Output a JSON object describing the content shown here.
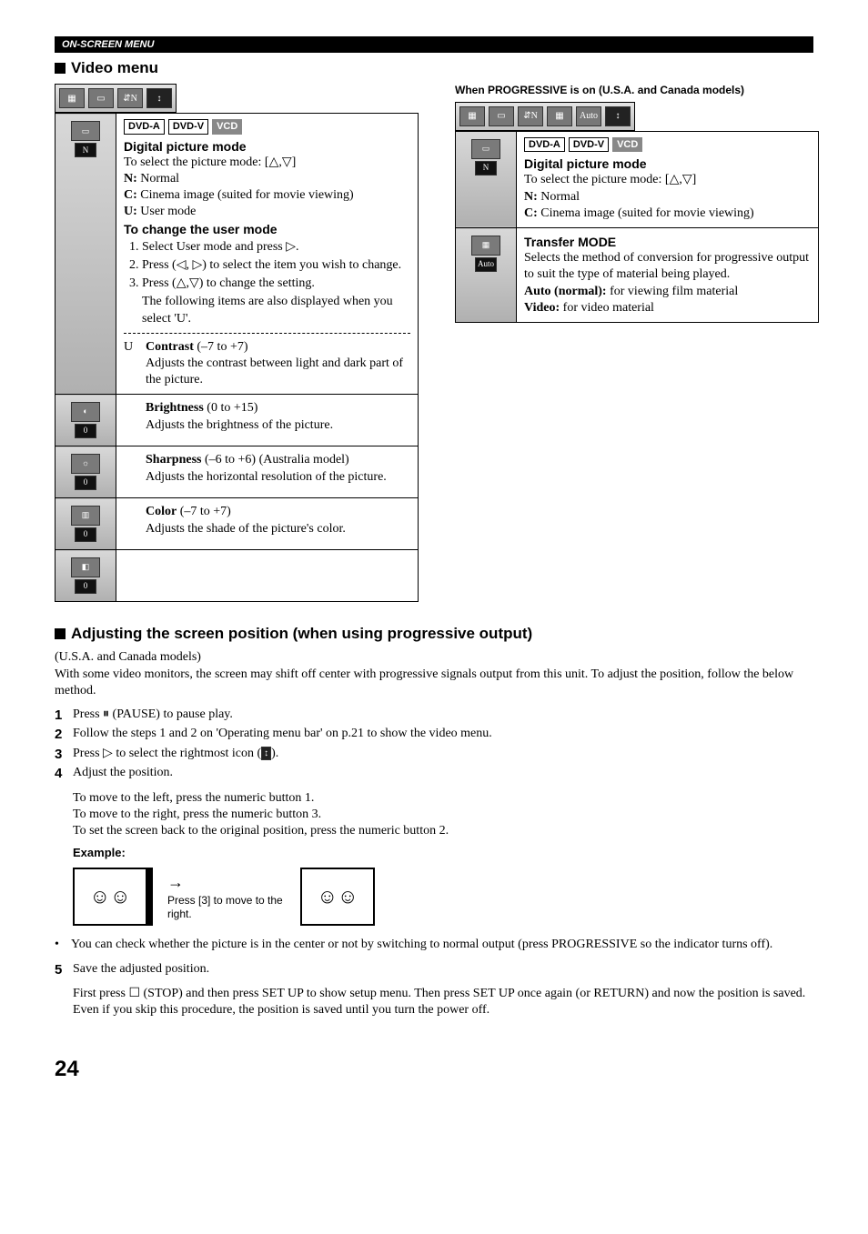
{
  "header": "ON-SCREEN MENU",
  "video_menu": {
    "title": "Video menu",
    "badges": [
      "DVD-A",
      "DVD-V",
      "VCD"
    ],
    "digital_picture_mode": {
      "title": "Digital picture mode",
      "select_line": "To select the picture mode: [△,▽]",
      "n_label": "N:",
      "n_text": "Normal",
      "c_label": "C:",
      "c_text": "Cinema image (suited for movie viewing)",
      "u_label": "U:",
      "u_text": "User mode",
      "change_title": "To change the user mode",
      "step1": "Select User mode and press ▷.",
      "step2": "Press (◁, ▷) to select the item you wish to change.",
      "step3": "Press (△,▽) to change the setting.",
      "followup": "The following items are also displayed when you select 'U'."
    },
    "u_row_label": "U",
    "contrast": {
      "title": "Contrast",
      "range": "(–7 to +7)",
      "desc": "Adjusts the contrast between light and dark part of the picture."
    },
    "brightness": {
      "title": "Brightness",
      "range": "(0 to +15)",
      "desc": "Adjusts the brightness of the picture."
    },
    "sharpness": {
      "title": "Sharpness",
      "range": "(–6 to +6)",
      "region": "(Australia model)",
      "desc": "Adjusts the horizontal resolution of the picture."
    },
    "color": {
      "title": "Color",
      "range": "(–7 to +7)",
      "desc": "Adjusts the shade of the picture's color."
    }
  },
  "progressive": {
    "note": "When PROGRESSIVE is on (U.S.A. and Canada models)",
    "badges": [
      "DVD-A",
      "DVD-V",
      "VCD"
    ],
    "dpm": {
      "title": "Digital picture mode",
      "select_line": "To select the picture mode: [△,▽]",
      "n_label": "N:",
      "n_text": "Normal",
      "c_label": "C:",
      "c_text": "Cinema image (suited for movie viewing)"
    },
    "transfer": {
      "title": "Transfer MODE",
      "desc": "Selects the method of conversion for progressive output to suit the type of material being played.",
      "auto_label": "Auto (normal):",
      "auto_text": "for viewing film material",
      "video_label": "Video:",
      "video_text": "for video material"
    },
    "auto_icon_label": "Auto"
  },
  "adjust": {
    "title": "Adjusting the screen position (when using progressive output)",
    "subtitle": "(U.S.A. and Canada models)",
    "intro": "With some video monitors, the screen may shift off center with progressive signals output from this unit. To adjust the position, follow the below method.",
    "step1": "Press ⏸ (PAUSE) to pause play.",
    "step2": "Follow the steps 1 and 2 on 'Operating menu bar' on p.21 to show the video menu.",
    "step3_a": "Press ▷ to select the rightmost icon (",
    "step3_b": ").",
    "step4": "Adjust the position.",
    "step4a": "To move to the left, press the numeric button 1.",
    "step4b": "To move to the right, press the numeric button 3.",
    "step4c": "To set the screen back to the original position, press the numeric button 2.",
    "example_label": "Example:",
    "example_caption": "Press [3] to move to the right.",
    "bullet": "You can check whether the picture is in the center or not by switching to normal output (press PROGRESSIVE so the indicator turns off).",
    "step5": "Save the adjusted position.",
    "step5a": "First press ☐ (STOP) and then press SET UP to show setup menu. Then press SET UP once again (or RETURN) and now the position is saved. Even if you skip this procedure, the position is saved until you turn the power off."
  },
  "page_number": "24"
}
